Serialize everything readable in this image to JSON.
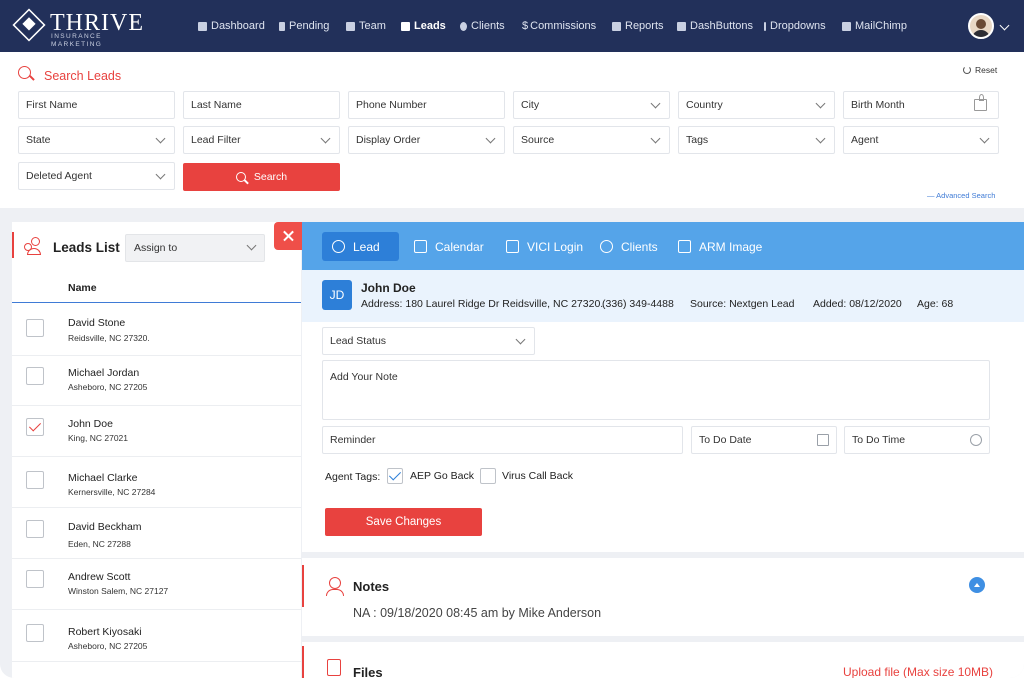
{
  "brand": {
    "name": "THRIVE",
    "tagline": "INSURANCE MARKETING"
  },
  "nav": {
    "items": [
      {
        "label": "Dashboard",
        "icon": "dashboard-icon"
      },
      {
        "label": "Pending",
        "icon": "hourglass-icon"
      },
      {
        "label": "Team",
        "icon": "team-icon"
      },
      {
        "label": "Leads",
        "icon": "leads-icon",
        "active": true
      },
      {
        "label": "Clients",
        "icon": "client-icon"
      },
      {
        "label": "Commissions",
        "icon": "dollar-icon"
      },
      {
        "label": "Reports",
        "icon": "report-icon"
      },
      {
        "label": "DashButtons",
        "icon": "briefcase-icon"
      },
      {
        "label": "Dropdowns",
        "icon": "dropdown-icon"
      },
      {
        "label": "MailChimp",
        "icon": "mail-icon"
      }
    ]
  },
  "search": {
    "title": "Search Leads",
    "reset_label": "Reset",
    "fields": {
      "first_name": "First Name",
      "last_name": "Last Name",
      "phone": "Phone Number",
      "city": "City",
      "country": "Country",
      "birth_month": "Birth Month",
      "state": "State",
      "lead_filter": "Lead Filter",
      "display_order": "Display Order",
      "source": "Source",
      "tags": "Tags",
      "agent": "Agent",
      "deleted_agent": "Deleted Agent"
    },
    "button_label": "Search",
    "advanced_label": "— Advanced Search"
  },
  "leads_list": {
    "title": "Leads List",
    "assign_label": "Assign to",
    "column_name": "Name",
    "rows": [
      {
        "name": "David Stone",
        "address": "Reidsville, NC 27320.",
        "checked": false
      },
      {
        "name": "Michael Jordan",
        "address": "Asheboro, NC 27205",
        "checked": false
      },
      {
        "name": "John Doe",
        "address": "King, NC 27021",
        "checked": true
      },
      {
        "name": "Michael Clarke",
        "address": "Kernersville, NC 27284",
        "checked": false
      },
      {
        "name": "David Beckham",
        "address": "Eden, NC 27288",
        "checked": false
      },
      {
        "name": "Andrew Scott",
        "address": "Winston Salem, NC 27127",
        "checked": false
      },
      {
        "name": "Robert Kiyosaki",
        "address": "Asheboro, NC 27205",
        "checked": false
      }
    ]
  },
  "tabs": [
    {
      "label": "Lead",
      "active": true
    },
    {
      "label": "Calendar"
    },
    {
      "label": "VICI Login"
    },
    {
      "label": "Clients"
    },
    {
      "label": "ARM Image"
    }
  ],
  "lead": {
    "initials": "JD",
    "name": "John Doe",
    "address": "Address: 180 Laurel Ridge Dr Reidsville, NC 27320.",
    "phone": "(336) 349-4488",
    "source": "Source: Nextgen Lead",
    "added": "Added: 08/12/2020",
    "age": "Age: 68"
  },
  "lead_form": {
    "status_placeholder": "Lead Status",
    "note_placeholder": "Add Your Note",
    "reminder_placeholder": "Reminder",
    "todo_date_placeholder": "To Do Date",
    "todo_time_placeholder": "To Do Time",
    "agent_tags_label": "Agent Tags:",
    "tags": [
      {
        "label": "AEP Go Back",
        "checked": true
      },
      {
        "label": "Virus Call Back",
        "checked": false
      }
    ],
    "save_label": "Save Changes"
  },
  "notes": {
    "title": "Notes",
    "entries": [
      "NA : 09/18/2020 08:45 am by Mike Anderson"
    ]
  },
  "files": {
    "title": "Files",
    "upload_label": "Upload file (Max size 10MB)"
  },
  "colors": {
    "nav_bg": "#22305a",
    "accent_red": "#e8423f",
    "tab_blue": "#55a4e9",
    "active_blue": "#2d7fd8"
  }
}
